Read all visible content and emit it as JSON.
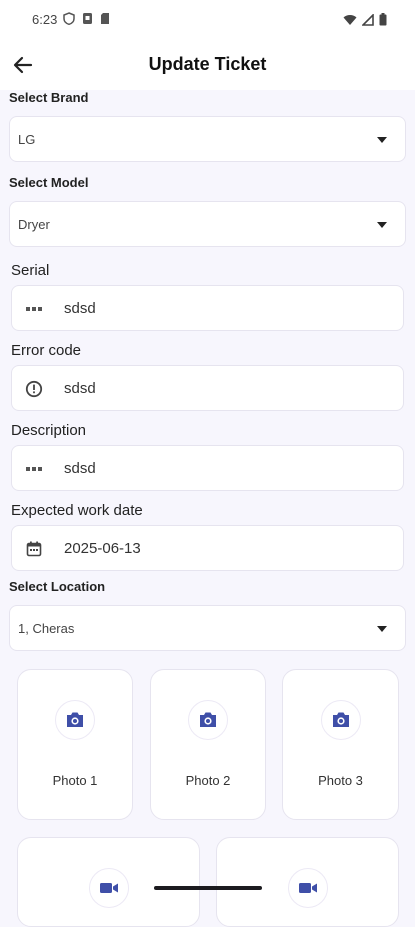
{
  "status_bar": {
    "time": "6:23"
  },
  "app_bar": {
    "title": "Update Ticket"
  },
  "form": {
    "brand": {
      "label": "Select Brand",
      "value": "LG"
    },
    "model": {
      "label": "Select Model",
      "value": "Dryer"
    },
    "serial": {
      "label": "Serial",
      "value": "sdsd"
    },
    "error_code": {
      "label": "Error code",
      "value": "sdsd"
    },
    "description": {
      "label": "Description",
      "value": "sdsd"
    },
    "work_date": {
      "label": "Expected work date",
      "value": "2025-06-13"
    },
    "location": {
      "label": "Select Location",
      "value": "1, Cheras"
    }
  },
  "photos": [
    {
      "label": "Photo 1",
      "icon": "camera-icon"
    },
    {
      "label": "Photo 2",
      "icon": "camera-icon"
    },
    {
      "label": "Photo 3",
      "icon": "camera-icon"
    }
  ],
  "videos": [
    {
      "icon": "video-camera-icon"
    },
    {
      "icon": "video-camera-icon"
    }
  ],
  "colors": {
    "accent": "#3f4fa8",
    "background": "#f7f6fd"
  }
}
